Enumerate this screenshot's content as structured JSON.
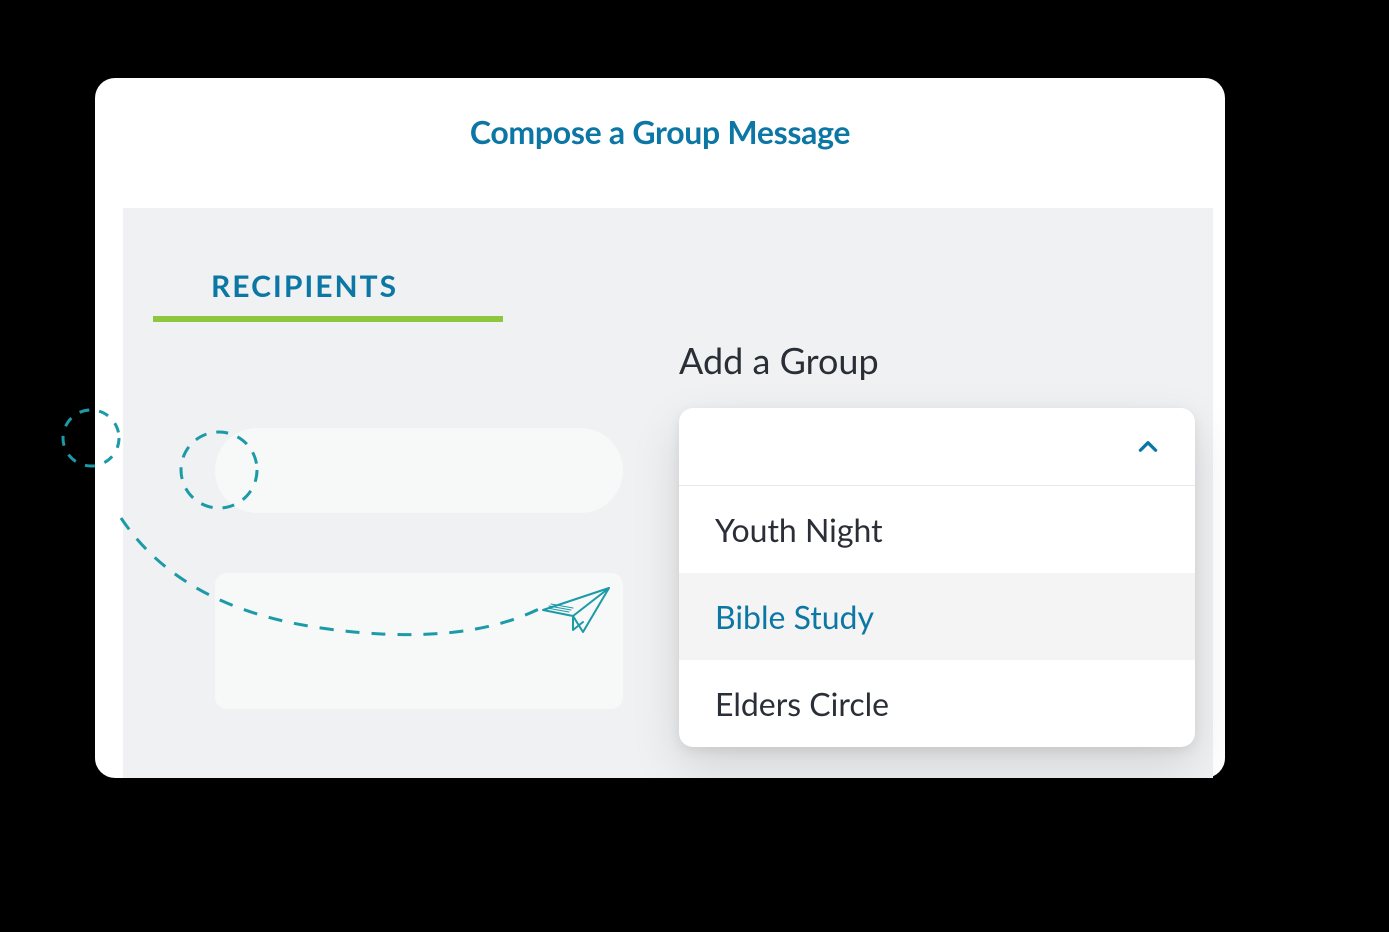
{
  "header": {
    "title": "Compose a Group Message"
  },
  "tabs": {
    "recipients_label": "RECIPIENTS"
  },
  "section": {
    "add_group_label": "Add a Group"
  },
  "dropdown": {
    "options": [
      {
        "label": "Youth Night"
      },
      {
        "label": "Bible Study"
      },
      {
        "label": "Elders Circle"
      }
    ],
    "selected_index": 1
  },
  "colors": {
    "accent_blue": "#0c77a5",
    "accent_green": "#8fc640",
    "teal": "#1b9aa7",
    "text_dark": "#2a2e36"
  },
  "icons": {
    "chevron_up": "chevron-up-icon",
    "paper_plane": "paper-plane-icon"
  }
}
